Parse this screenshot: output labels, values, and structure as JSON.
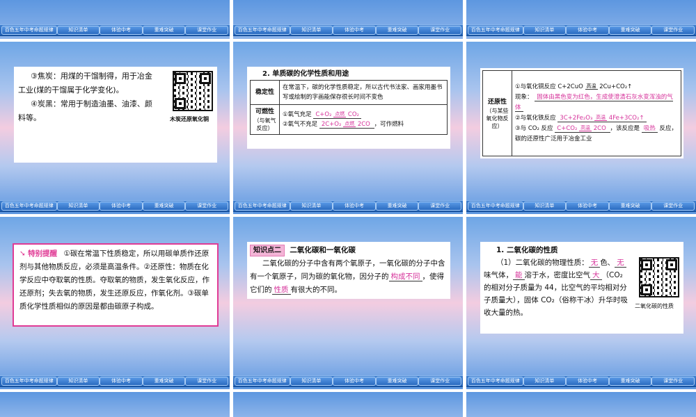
{
  "nav": [
    "百色五年中考命题规律",
    "知识清单",
    "体验中考",
    "重难突破",
    "课堂作业"
  ],
  "slide1": {
    "line1": "③焦炭：用煤的干馏制得，用于冶金",
    "line2": "工业(煤的干馏属于化学变化)。",
    "line3": "④炭黑：常用于制造油墨、油漆、颜",
    "line4": "料等。",
    "qr_caption": "木炭还原氧化铜"
  },
  "slide2": {
    "title": "2. 单质碳的化学性质和用途",
    "stability_head": "稳定性",
    "stability_text": "在常温下，碳的化学性质稳定，所以古代书法家、画家用墨书写或绘制的字画能保存很长时间不变色",
    "combust_head": "可燃性",
    "combust_sub": "（与氧气反应）",
    "c1_prefix": "①氧气充足",
    "c1_cond": "点燃",
    "c1_left": "C+O₂",
    "c1_right": "CO₂",
    "c2_prefix": "②氧气不充足",
    "c2_left": "2C+O₂",
    "c2_cond": "点燃",
    "c2_right": "2CO",
    "c2_suffix": "，可作燃料"
  },
  "slide3": {
    "head": "还原性",
    "sub": "（与某些氧化物反应）",
    "r1_prefix": "①与氧化铜反应 C+2CuO",
    "r1_cond": "高温",
    "r1_right": "2Cu+CO₂↑",
    "r1_phen_label": "现象：",
    "r1_phen": "固体由黑色变为红色，生成使澄清石灰水变浑浊的气体",
    "r2_prefix": "②与氧化铁反应",
    "r2_left": "3C+2Fe₂O₃",
    "r2_cond": "高温",
    "r2_right": "4Fe+3CO₂↑",
    "r3_prefix": "③与 CO₂ 反应",
    "r3_left": "C+CO₂",
    "r3_cond": "高温",
    "r3_right": "2CO",
    "r3_mid": "，该反应是",
    "r3_ans": "吸热",
    "r3_suffix": "反应，碳的还原性广泛用于冶金工业"
  },
  "slide4": {
    "label": "特别提醒",
    "text1": "①碳在常温下性质稳定，所以用碳单质作还原剂与其他物质反应，必须是高温条件。②还原性：物质在化学反应中夺取氧的性质。夺取氧的物质，发生氧化反应，作还原剂；失去氧的物质，发生还原反应，作氧化剂。③碳单质化学性质相似的原因是都由碳原子构成。"
  },
  "slide5": {
    "tag": "知识点二",
    "title": "二氧化碳和一氧化碳",
    "t1": "二氧化碳的分子中含有两个氧原子，一氧化碳的分子中含有一个氧原子，同为碳的氧化物，因分子的",
    "a1": "构成不同",
    "t2": "，使得它们的",
    "a2": "性质",
    "t3": "有很大的不同。"
  },
  "slide6": {
    "title": "1. 二氧化碳的性质",
    "p1": "（1）二氧化碳的物理性质：",
    "a1": "无",
    "p2": "色、",
    "a2": "无",
    "p3": "味气体，",
    "a3": "能",
    "p4": "溶于水，密度比空气",
    "a4": "大",
    "p5": "（CO₂ 的相对分子质量为 44，比空气的平均相对分子质量大），固体 CO₂（俗称干冰）升华时吸收大量的热。",
    "qr_caption": "二氧化碳的性质"
  }
}
